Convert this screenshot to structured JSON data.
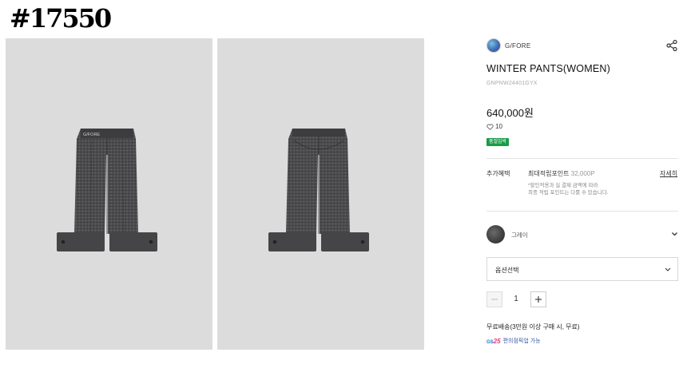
{
  "page_id": "#17550",
  "brand": {
    "name": "G/FORE",
    "logo_icon": "brand-avatar-icon"
  },
  "share": {
    "icon": "share-icon"
  },
  "product": {
    "title": "WINTER PANTS(WOMEN)",
    "code": "GNPNW24401GYX",
    "price": "640,000원",
    "likes": "10",
    "badge": "품절임박",
    "images": [
      {
        "view": "front",
        "waist_text": "G/FORE"
      },
      {
        "view": "back"
      }
    ]
  },
  "benefits": {
    "label": "추가혜택",
    "points_label": "최대적립포인트",
    "points_value": "32,000P",
    "detail_link": "자세히",
    "note_line1": "*할인적용과 실 결제 금액에 따라",
    "note_line2": "최종 적립 포인트는 다를 수 있습니다."
  },
  "color": {
    "name": "그레이",
    "swatch": "#4a4a4a"
  },
  "option": {
    "label": "옵션선택"
  },
  "quantity": {
    "value": "1"
  },
  "shipping": {
    "text": "무료배송(3만원 이상 구매 시, 무료)",
    "gs_logo_text": "GS",
    "gs_logo_num": "25",
    "gs_text": "편의점픽업 가능"
  },
  "colors": {
    "badge_green": "#1a9b48",
    "panel_bg": "#dcdcdc",
    "gs_blue": "#3a5ba5"
  }
}
